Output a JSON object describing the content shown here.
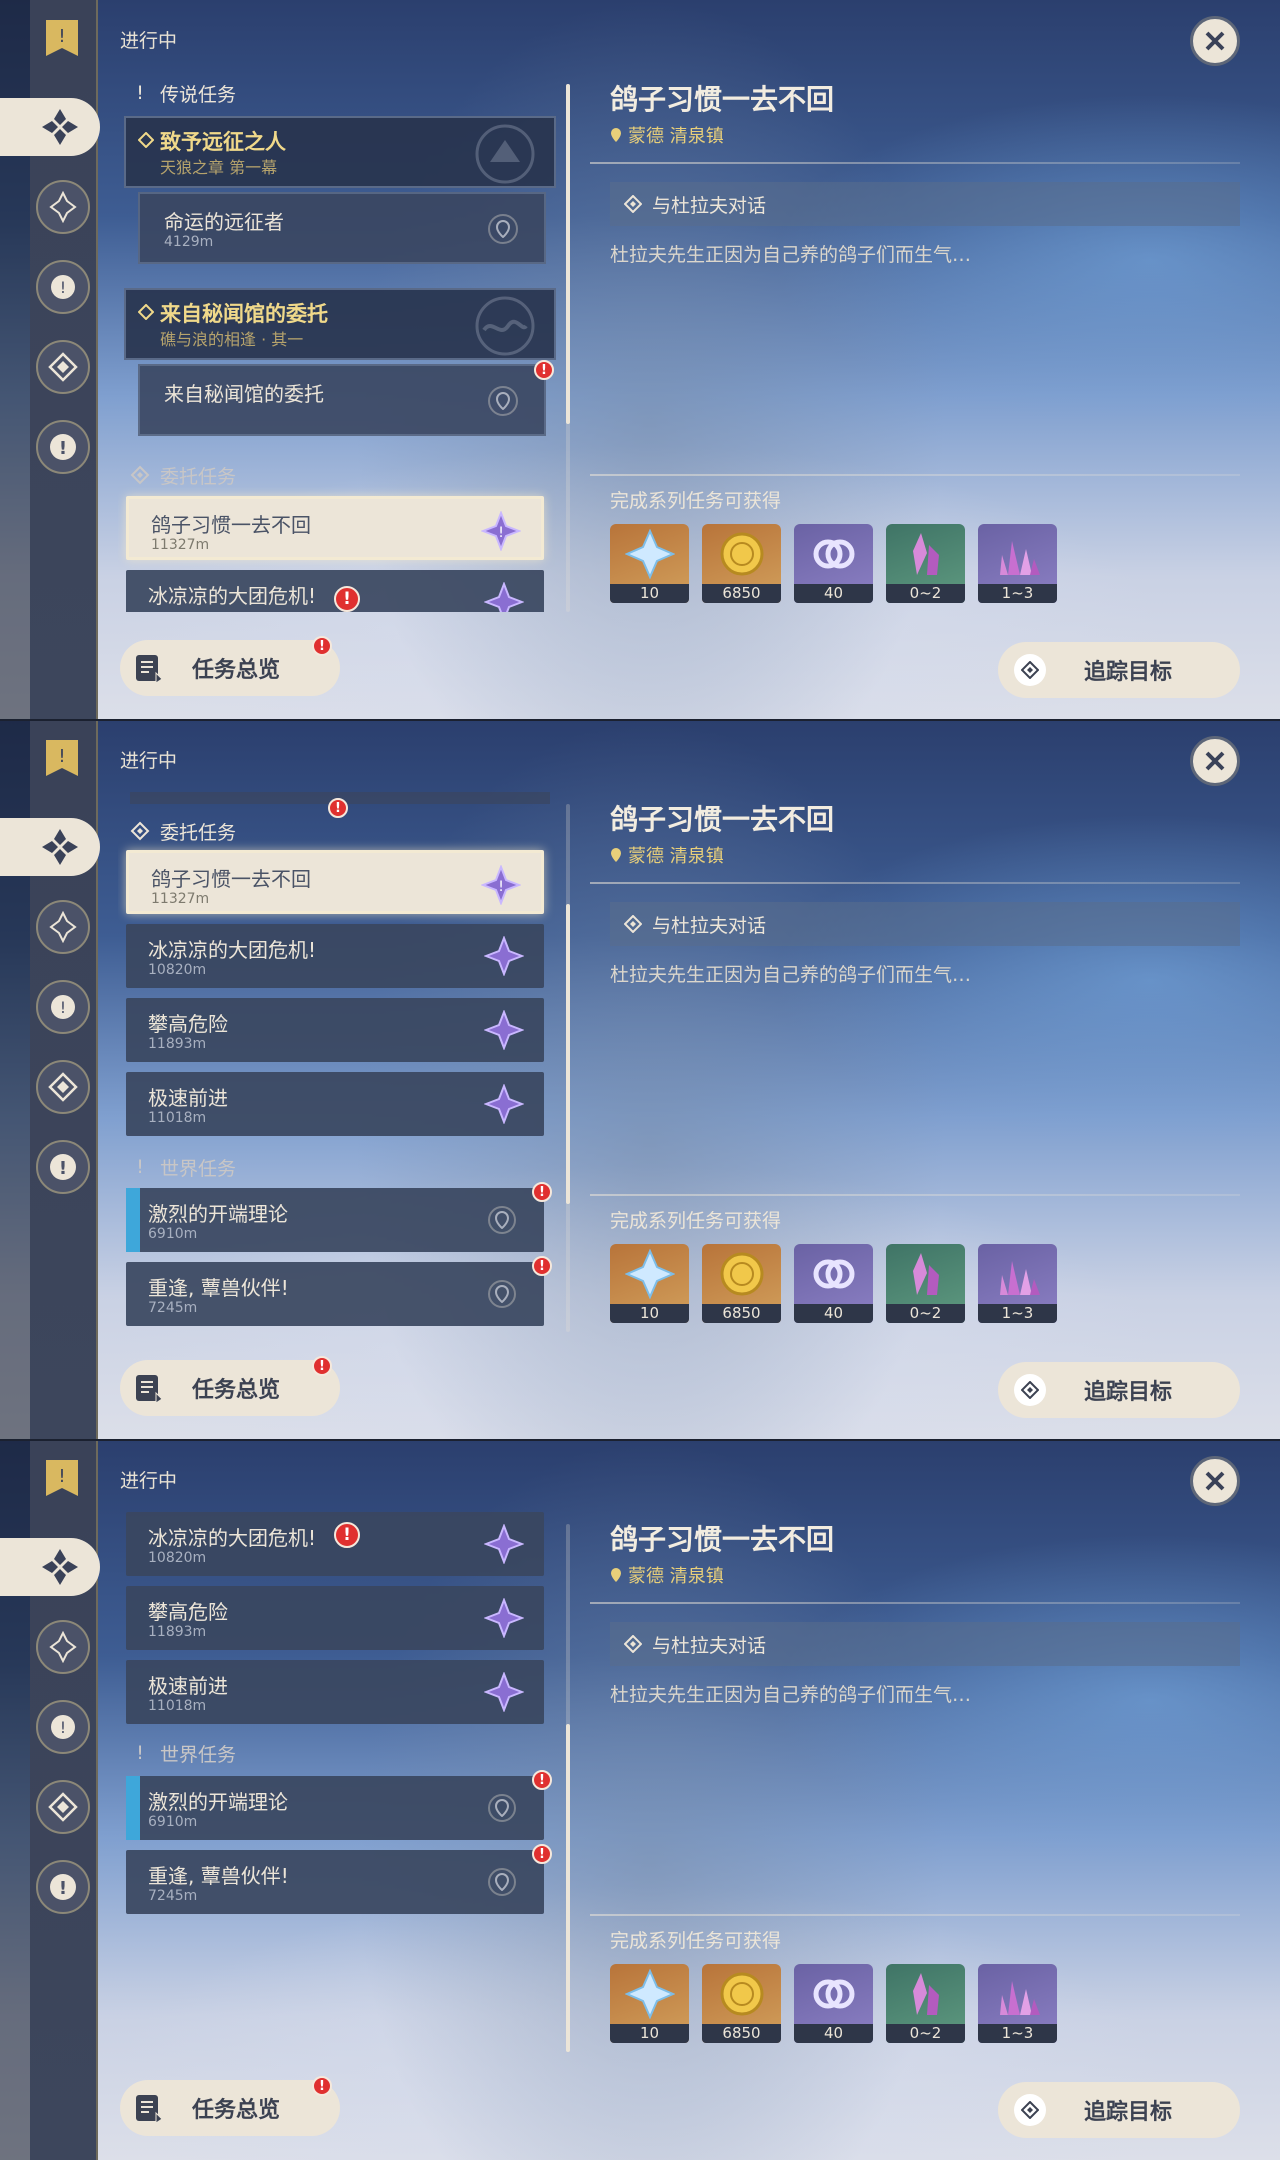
{
  "header": {
    "in_progress": "进行中"
  },
  "categories": {
    "legend": "传说任务",
    "commission": "委托任务",
    "world": "世界任务"
  },
  "legend_quests": [
    {
      "title": "致予远征之人",
      "chapter": "天狼之章 第一幕",
      "sub_title": "命运的远征者",
      "sub_distance": "4129m"
    },
    {
      "title": "来自秘闻馆的委托",
      "chapter": "礁与浪的相逢 · 其一",
      "sub_title": "来自秘闻馆的委托",
      "sub_distance": ""
    }
  ],
  "commission_quests": [
    {
      "title": "鸽子习惯一去不回",
      "distance": "11327m"
    },
    {
      "title": "冰凉凉的大团危机!",
      "distance": "10820m"
    },
    {
      "title": "攀高危险",
      "distance": "11893m"
    },
    {
      "title": "极速前进",
      "distance": "11018m"
    }
  ],
  "world_quests": [
    {
      "title": "激烈的开端理论",
      "distance": "6910m"
    },
    {
      "title": "重逢, 蕈兽伙伴!",
      "distance": "7245m"
    }
  ],
  "detail": {
    "title": "鸽子习惯一去不回",
    "location": "蒙德 清泉镇",
    "step": "与杜拉夫对话",
    "description": "杜拉夫先生正因为自己养的鸽子们而生气…",
    "rewards_title": "完成系列任务可获得",
    "rewards": [
      {
        "icon": "primogem-icon",
        "count": "10"
      },
      {
        "icon": "mora-icon",
        "count": "6850"
      },
      {
        "icon": "companionship-exp-icon",
        "count": "40"
      },
      {
        "icon": "crystal-small-icon",
        "count": "0~2"
      },
      {
        "icon": "crystal-cluster-icon",
        "count": "1~3"
      }
    ]
  },
  "buttons": {
    "overview": "任务总览",
    "track": "追踪目标"
  },
  "badge_mark": "!",
  "colors": {
    "accent_gold": "#e8cf7a",
    "card_light": "#ece5d8",
    "badge_red": "#e0302f",
    "world_select": "#3ea7da"
  }
}
